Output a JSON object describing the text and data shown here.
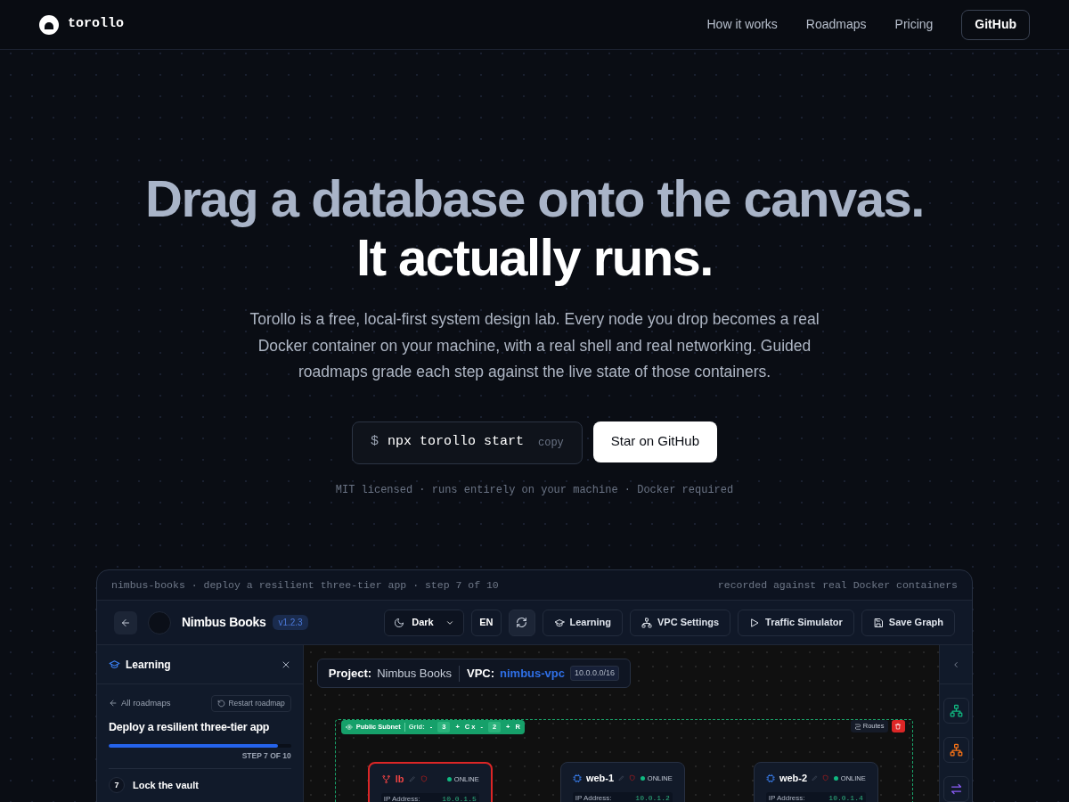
{
  "nav": {
    "brand": "torollo",
    "links": [
      "How it works",
      "Roadmaps",
      "Pricing"
    ],
    "github": "GitHub"
  },
  "hero": {
    "title_line_1": "Drag a database onto the canvas.",
    "title_line_2": "It actually runs.",
    "description": "Torollo is a free, local-first system design lab. Every node you drop becomes a real Docker container on your machine, with a real shell and real networking. Guided roadmaps grade each step against the live state of those containers.",
    "command": {
      "prompt": "$",
      "text": "npx torollo start",
      "copy": "copy"
    },
    "star_button": "Star on GitHub",
    "footnote": "MIT licensed · runs entirely on your machine · Docker required"
  },
  "demo": {
    "caption_left": "nimbus-books · deploy a resilient three-tier app · step 7 of 10",
    "caption_right": "recorded against real Docker containers",
    "toolbar": {
      "project_name": "Nimbus Books",
      "version": "v1.2.3",
      "theme": "Dark",
      "language": "EN",
      "buttons": [
        {
          "kind": "learning",
          "label": "Learning"
        },
        {
          "kind": "vpc",
          "label": "VPC Settings"
        },
        {
          "kind": "traffic",
          "label": "Traffic Simulator"
        },
        {
          "kind": "save",
          "label": "Save Graph"
        }
      ]
    },
    "sidebar": {
      "title": "Learning",
      "back_link": "All roadmaps",
      "restart": "Restart roadmap",
      "roadmap_title": "Deploy a resilient three-tier app",
      "level": 0.93,
      "step_label": "STEP 7 OF 10",
      "step_number": "7",
      "step_title": "Lock the vault"
    },
    "canvas": {
      "project_label": "Project:",
      "project": "Nimbus Books",
      "vpc_label": "VPC:",
      "vpc": "nimbus-vpc",
      "cidr": "10.0.0.0/16",
      "subnet": {
        "name": "Public Subnet",
        "grid_label": "Grid:",
        "col_dec": "-",
        "columns": "3",
        "col_inc": "+",
        "col_unit": "C x",
        "row_dec": "-",
        "rows": "2",
        "row_inc": "+",
        "row_unit": "R",
        "routes": "Routes"
      },
      "nodes": [
        {
          "kind": "lb",
          "name": "lb",
          "selected": true,
          "status": "ONLINE",
          "ip_label": "IP Address:",
          "ip": "10.0.1.5"
        },
        {
          "kind": "web",
          "name": "web-1",
          "selected": false,
          "status": "ONLINE",
          "ip_label": "IP Address:",
          "ip": "10.0.1.2"
        },
        {
          "kind": "web",
          "name": "web-2",
          "selected": false,
          "status": "ONLINE",
          "ip_label": "IP Address:",
          "ip": "10.0.1.4"
        }
      ]
    }
  }
}
